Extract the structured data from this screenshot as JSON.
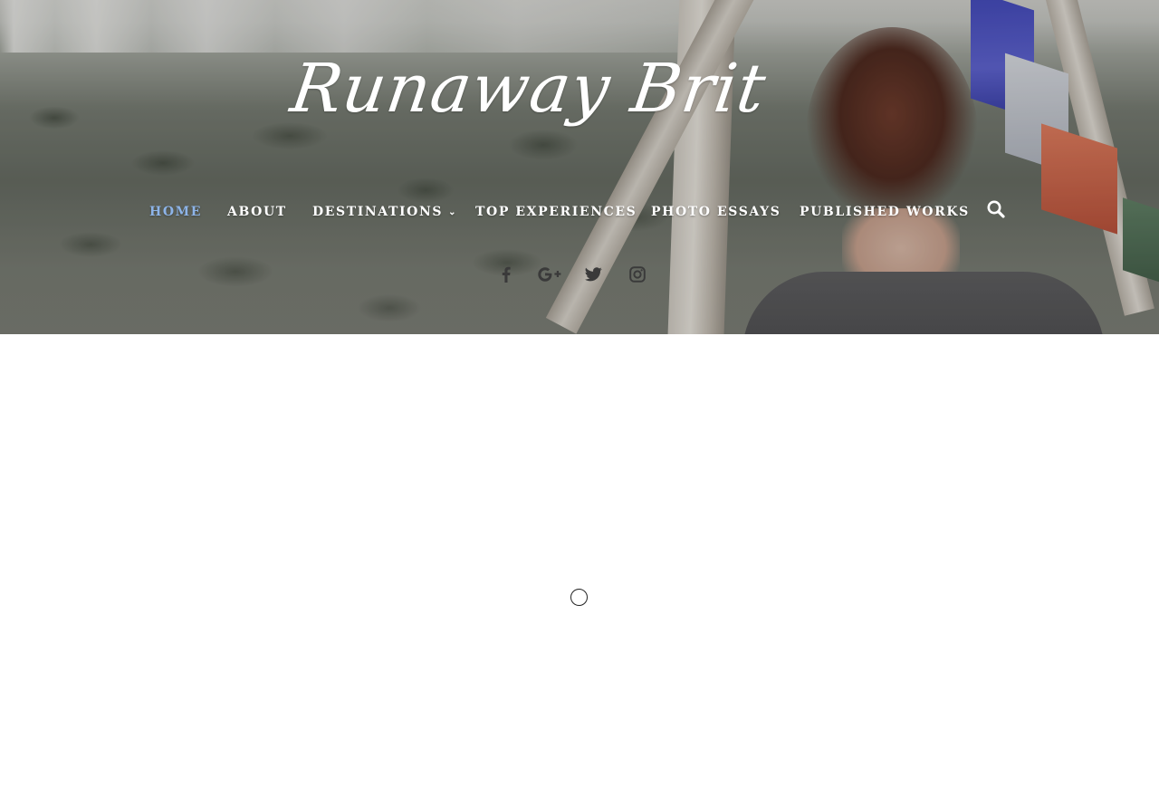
{
  "site": {
    "logo_text": "Runaway Brit"
  },
  "nav": {
    "items": [
      {
        "label": "HOME",
        "active": true
      },
      {
        "label": "ABOUT",
        "active": false
      },
      {
        "label": "DESTINATIONS",
        "active": false,
        "has_dropdown": true
      },
      {
        "label": "TOP EXPERIENCES",
        "active": false
      },
      {
        "label": "PHOTO ESSAYS",
        "active": false
      },
      {
        "label": "PUBLISHED WORKS",
        "active": false
      }
    ],
    "dropdown_icon": "chevron-down-icon",
    "search_icon": "search-icon",
    "active_color": "#8db4e8",
    "text_color": "#ffffff"
  },
  "social": {
    "icons": [
      "facebook-icon",
      "google-plus-icon",
      "twitter-icon",
      "instagram-icon"
    ],
    "icon_color": "#3a3a3a"
  },
  "body": {
    "loading_indicator": "spinner-icon",
    "background_color": "#ffffff"
  }
}
